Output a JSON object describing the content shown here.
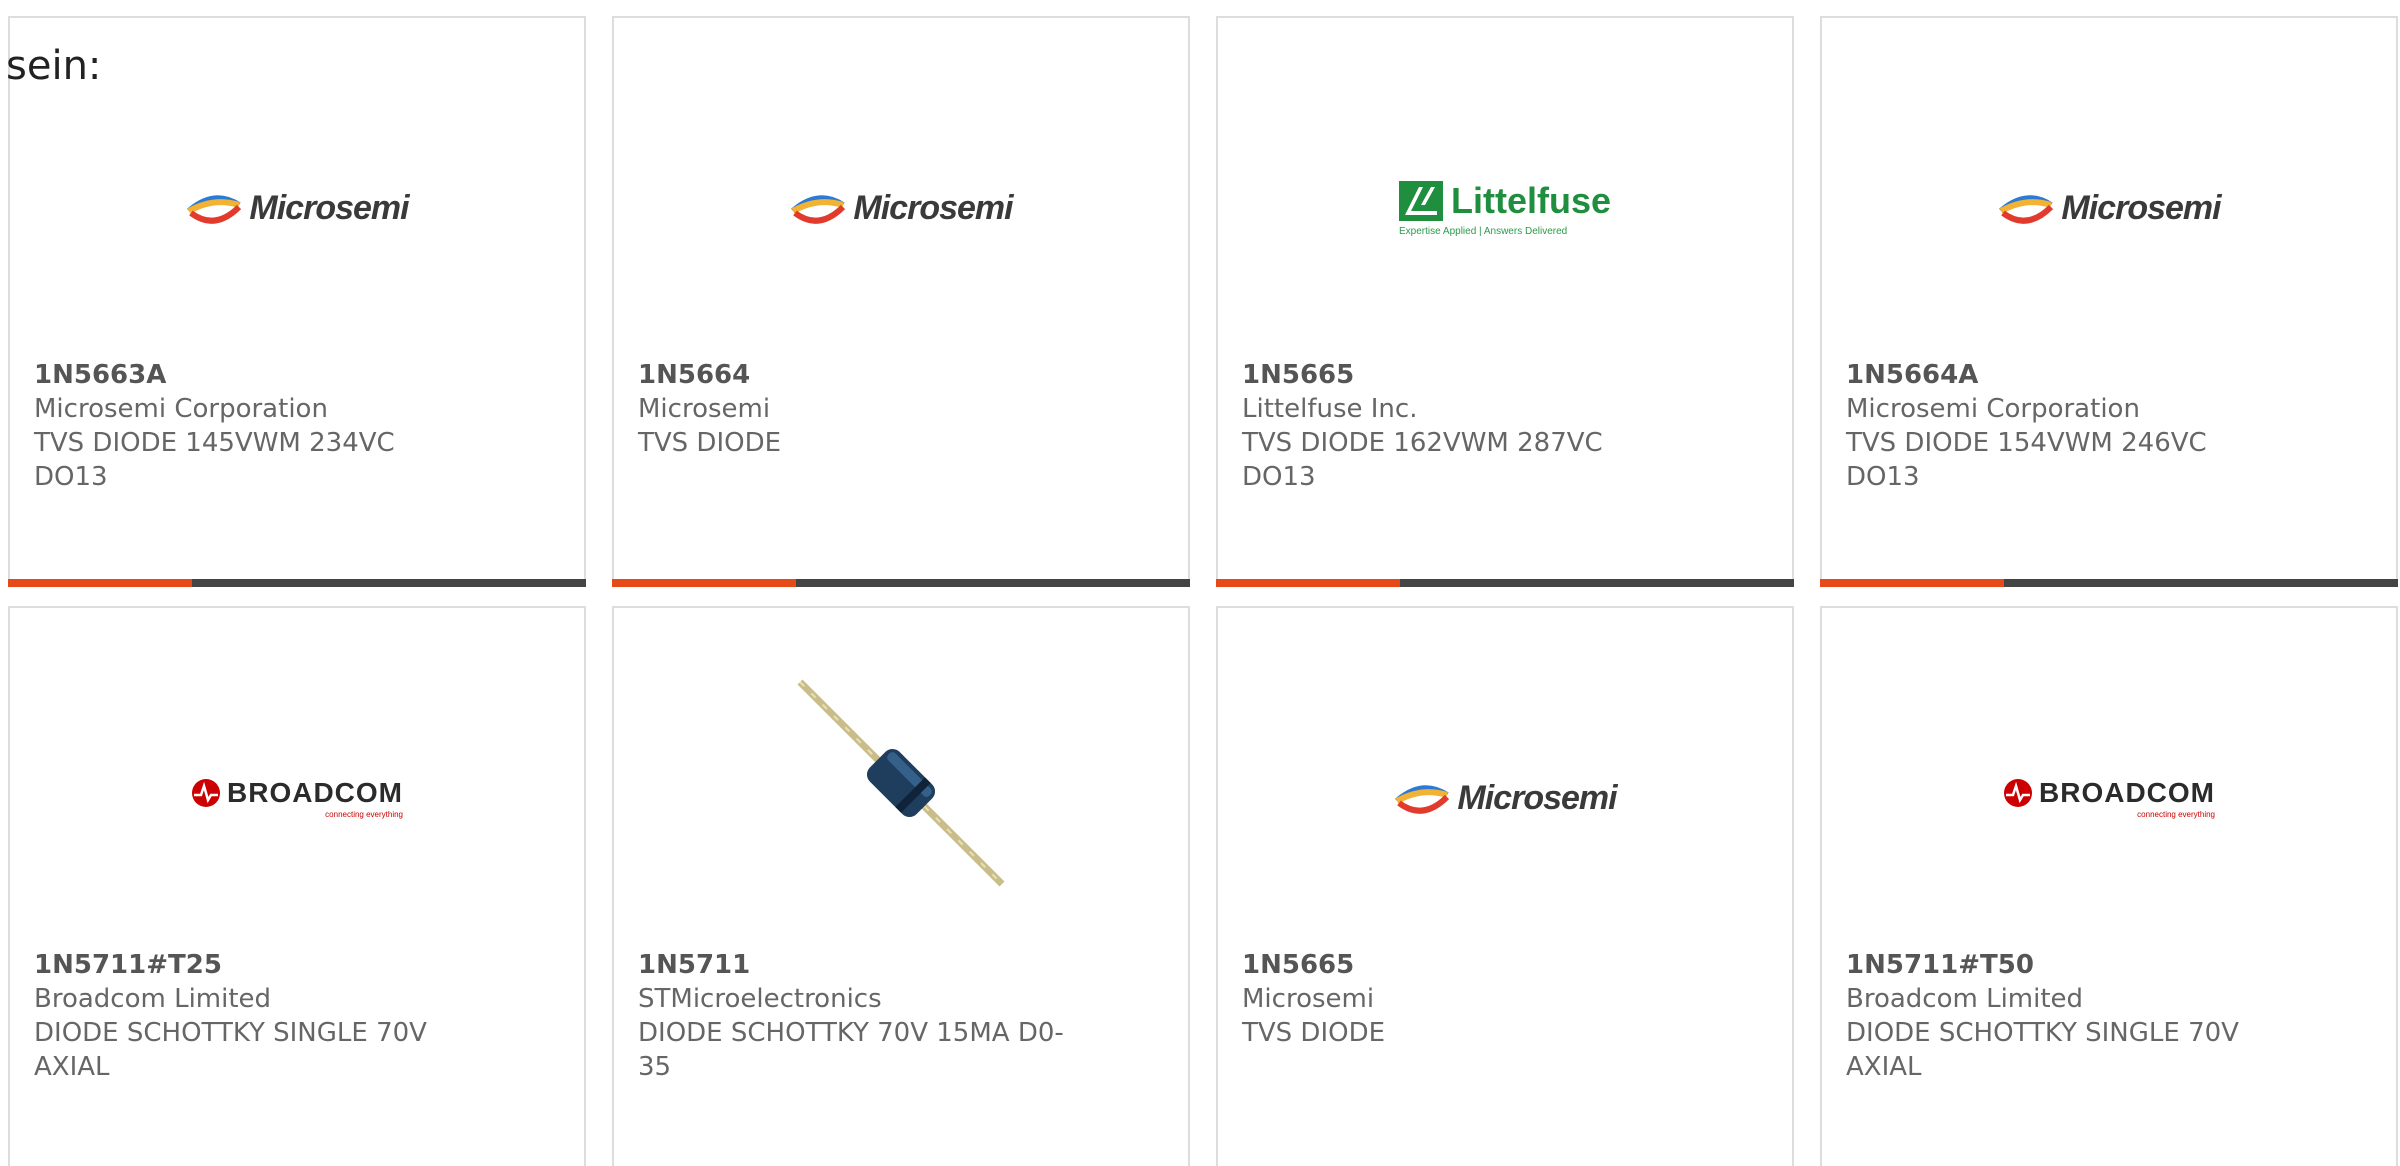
{
  "intro_text": "sein:",
  "colors": {
    "accent_bar": "#e64a19",
    "bar": "#444444",
    "text": "#666666"
  },
  "cards": [
    {
      "part": "1N5663A",
      "maker": "Microsemi Corporation",
      "desc_line1": "TVS DIODE 145VWM 234VC",
      "desc_line2": "DO13",
      "logo": "Microsemi"
    },
    {
      "part": "1N5664",
      "maker": "Microsemi",
      "desc_line1": "TVS DIODE",
      "desc_line2": "",
      "logo": "Microsemi"
    },
    {
      "part": "1N5665",
      "maker": "Littelfuse Inc.",
      "desc_line1": "TVS DIODE 162VWM 287VC",
      "desc_line2": "DO13",
      "logo": "Littelfuse",
      "logo_tagline": "Expertise Applied | Answers Delivered"
    },
    {
      "part": "1N5664A",
      "maker": "Microsemi Corporation",
      "desc_line1": "TVS DIODE 154VWM 246VC",
      "desc_line2": "DO13",
      "logo": "Microsemi"
    },
    {
      "part": "1N5711#T25",
      "maker": "Broadcom Limited",
      "desc_line1": "DIODE SCHOTTKY SINGLE 70V",
      "desc_line2": "AXIAL",
      "logo": "BROADCOM",
      "logo_tagline": "connecting everything"
    },
    {
      "part": "1N5711",
      "maker": "STMicroelectronics",
      "desc_line1": "DIODE SCHOTTKY 70V 15MA D0-",
      "desc_line2": "35",
      "logo": "diode-photo"
    },
    {
      "part": "1N5665",
      "maker": "Microsemi",
      "desc_line1": "TVS DIODE",
      "desc_line2": "",
      "logo": "Microsemi"
    },
    {
      "part": "1N5711#T50",
      "maker": "Broadcom Limited",
      "desc_line1": "DIODE SCHOTTKY SINGLE 70V",
      "desc_line2": "AXIAL",
      "logo": "BROADCOM",
      "logo_tagline": "connecting everything"
    }
  ]
}
